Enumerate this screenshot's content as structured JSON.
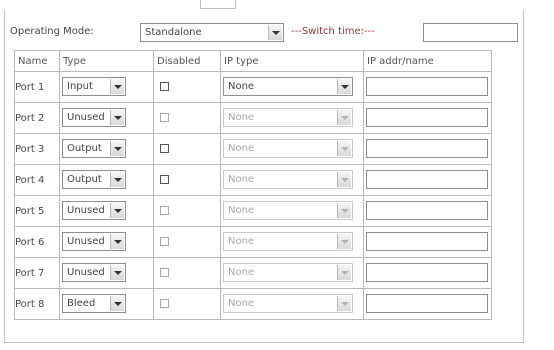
{
  "operating_mode": {
    "label": "Operating Mode:",
    "value": "Standalone"
  },
  "switch_time": {
    "label": "---Switch time:---",
    "value": ""
  },
  "table": {
    "headers": [
      "Name",
      "Type",
      "Disabled",
      "IP type",
      "IP addr/name"
    ],
    "rows": [
      {
        "name": "Port 1",
        "type": "Input",
        "disabled": false,
        "ip_type": "None",
        "ip_enabled": true,
        "ip_addr": ""
      },
      {
        "name": "Port 2",
        "type": "Unused",
        "disabled": false,
        "ip_type": "None",
        "ip_enabled": false,
        "ip_addr": ""
      },
      {
        "name": "Port 3",
        "type": "Output",
        "disabled": false,
        "ip_type": "None",
        "ip_enabled": false,
        "ip_addr": ""
      },
      {
        "name": "Port 4",
        "type": "Output",
        "disabled": false,
        "ip_type": "None",
        "ip_enabled": false,
        "ip_addr": ""
      },
      {
        "name": "Port 5",
        "type": "Unused",
        "disabled": false,
        "ip_type": "None",
        "ip_enabled": false,
        "ip_addr": ""
      },
      {
        "name": "Port 6",
        "type": "Unused",
        "disabled": false,
        "ip_type": "None",
        "ip_enabled": false,
        "ip_addr": ""
      },
      {
        "name": "Port 7",
        "type": "Unused",
        "disabled": false,
        "ip_type": "None",
        "ip_enabled": false,
        "ip_addr": ""
      },
      {
        "name": "Port 8",
        "type": "Bleed",
        "disabled": false,
        "ip_type": "None",
        "ip_enabled": false,
        "ip_addr": ""
      }
    ]
  }
}
